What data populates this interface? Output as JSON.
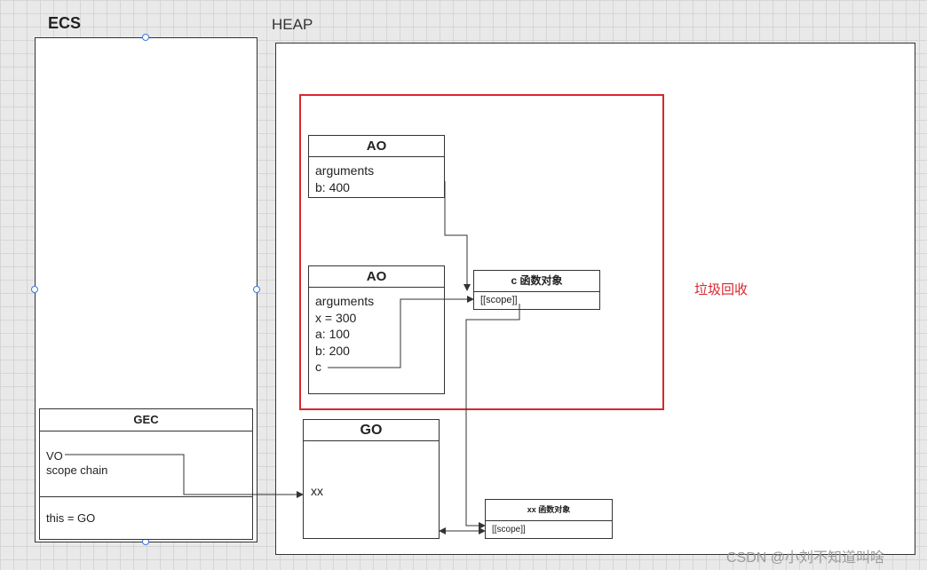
{
  "ecs": {
    "title": "ECS"
  },
  "heap": {
    "title": "HEAP"
  },
  "gec": {
    "title": "GEC",
    "lines": [
      "VO",
      "scope chain"
    ],
    "this_line": "this = GO"
  },
  "ao_top": {
    "title": "AO",
    "lines": [
      "arguments",
      "b: 400"
    ]
  },
  "ao_bottom": {
    "title": "AO",
    "lines": [
      "arguments",
      "x = 300",
      "a: 100",
      "b: 200",
      "c"
    ]
  },
  "c_func": {
    "title": "c 函数对象",
    "scope": "[[scope]]"
  },
  "go": {
    "title": "GO",
    "item": "xx"
  },
  "xx_func": {
    "title": "xx 函数对象",
    "scope": "[[scope]]"
  },
  "gc_label": "垃圾回收",
  "watermark": "CSDN @小刘不知道叫啥",
  "colors": {
    "gc_frame": "#d9272e",
    "handle": "#3a7bd5"
  }
}
